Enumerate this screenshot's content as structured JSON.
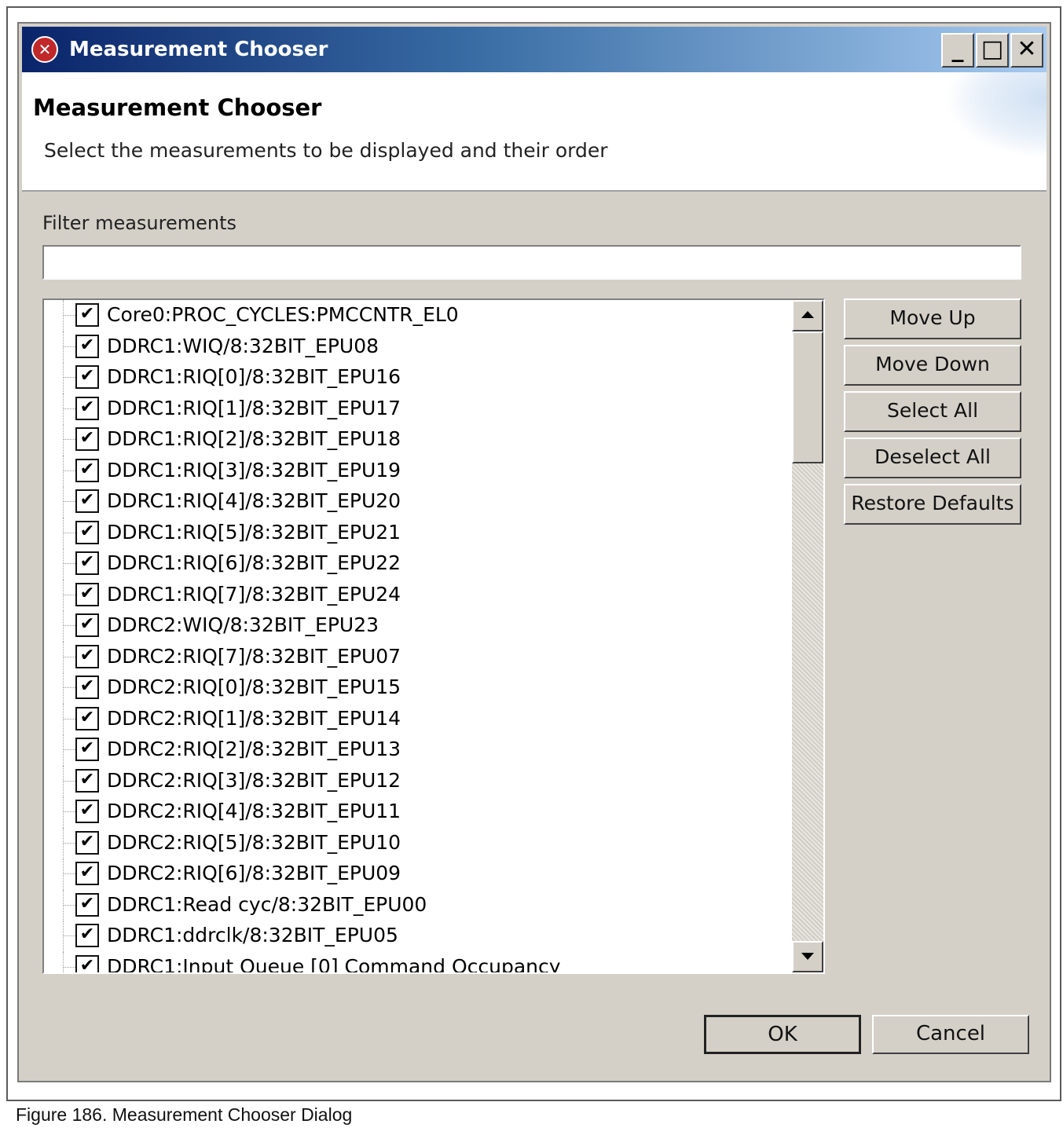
{
  "window": {
    "title": "Measurement Chooser",
    "min_glyph": "_",
    "max_glyph": "□",
    "close_glyph": "✕"
  },
  "header": {
    "title": "Measurement Chooser",
    "description": "Select the measurements to be displayed and their order"
  },
  "filter": {
    "label": "Filter measurements",
    "value": ""
  },
  "measurements": [
    {
      "label": "Core0:PROC_CYCLES:PMCCNTR_EL0",
      "checked": true
    },
    {
      "label": "DDRC1:WIQ/8:32BIT_EPU08",
      "checked": true
    },
    {
      "label": "DDRC1:RIQ[0]/8:32BIT_EPU16",
      "checked": true
    },
    {
      "label": "DDRC1:RIQ[1]/8:32BIT_EPU17",
      "checked": true
    },
    {
      "label": "DDRC1:RIQ[2]/8:32BIT_EPU18",
      "checked": true
    },
    {
      "label": "DDRC1:RIQ[3]/8:32BIT_EPU19",
      "checked": true
    },
    {
      "label": "DDRC1:RIQ[4]/8:32BIT_EPU20",
      "checked": true
    },
    {
      "label": "DDRC1:RIQ[5]/8:32BIT_EPU21",
      "checked": true
    },
    {
      "label": "DDRC1:RIQ[6]/8:32BIT_EPU22",
      "checked": true
    },
    {
      "label": "DDRC1:RIQ[7]/8:32BIT_EPU24",
      "checked": true
    },
    {
      "label": "DDRC2:WIQ/8:32BIT_EPU23",
      "checked": true
    },
    {
      "label": "DDRC2:RIQ[7]/8:32BIT_EPU07",
      "checked": true
    },
    {
      "label": "DDRC2:RIQ[0]/8:32BIT_EPU15",
      "checked": true
    },
    {
      "label": "DDRC2:RIQ[1]/8:32BIT_EPU14",
      "checked": true
    },
    {
      "label": "DDRC2:RIQ[2]/8:32BIT_EPU13",
      "checked": true
    },
    {
      "label": "DDRC2:RIQ[3]/8:32BIT_EPU12",
      "checked": true
    },
    {
      "label": "DDRC2:RIQ[4]/8:32BIT_EPU11",
      "checked": true
    },
    {
      "label": "DDRC2:RIQ[5]/8:32BIT_EPU10",
      "checked": true
    },
    {
      "label": "DDRC2:RIQ[6]/8:32BIT_EPU09",
      "checked": true
    },
    {
      "label": "DDRC1:Read cyc/8:32BIT_EPU00",
      "checked": true
    },
    {
      "label": "DDRC1:ddrclk/8:32BIT_EPU05",
      "checked": true
    },
    {
      "label": "DDRC1:Input Queue [0] Command Occupancy",
      "checked": true
    }
  ],
  "side_buttons": {
    "move_up": "Move Up",
    "move_down": "Move Down",
    "select_all": "Select All",
    "deselect_all": "Deselect All",
    "restore_defaults": "Restore Defaults"
  },
  "footer": {
    "ok": "OK",
    "cancel": "Cancel"
  },
  "caption": "Figure 186.  Measurement Chooser Dialog",
  "check_glyph": "✔",
  "colors": {
    "titlebar_start": "#0a246a",
    "titlebar_end": "#a6caf0",
    "dialog_bg": "#d4d0c8"
  }
}
